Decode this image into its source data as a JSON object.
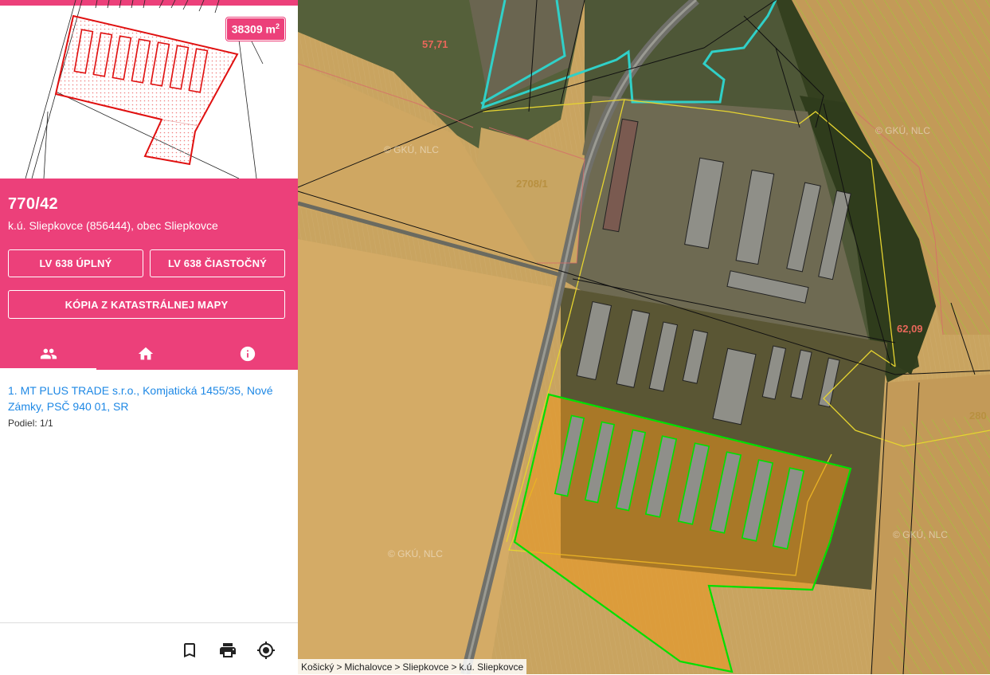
{
  "parcel": {
    "area_value": "38309 m",
    "area_unit_exp": "2",
    "id": "770/42",
    "location": "k.ú. Sliepkovce (856444), obec Sliepkovce"
  },
  "buttons": {
    "lv_full": "LV 638 ÚPLNÝ",
    "lv_partial": "LV 638 ČIASTOČNÝ",
    "map_copy": "KÓPIA Z KATASTRÁLNEJ MAPY"
  },
  "tabs": [
    {
      "icon": "people-icon",
      "active": true
    },
    {
      "icon": "home-icon",
      "active": false
    },
    {
      "icon": "info-icon",
      "active": false
    }
  ],
  "owners": [
    {
      "text": "1. MT PLUS TRADE s.r.o., Komjatická 1455/35, Nové Zámky, PSČ 940 01, SR",
      "share": "Podiel: 1/1"
    }
  ],
  "footer_icons": [
    "bookmark-icon",
    "print-icon",
    "locate-icon"
  ],
  "map": {
    "labels": [
      {
        "text": "57,71"
      },
      {
        "text": "2708/1"
      },
      {
        "text": "62,09"
      },
      {
        "text": "280"
      }
    ],
    "watermarks": [
      "© GKÚ, NLC",
      "© GKÚ, NLC",
      "© GKÚ, NLC",
      "© GKÚ, NLC"
    ]
  },
  "breadcrumb": [
    "Košický",
    "Michalovce",
    "Sliepkovce",
    "k.ú. Sliepkovce"
  ],
  "colors": {
    "accent": "#ec407a",
    "link": "#1e88e5",
    "parcel_outline": "#00e000",
    "preview_outline": "#e01010"
  }
}
